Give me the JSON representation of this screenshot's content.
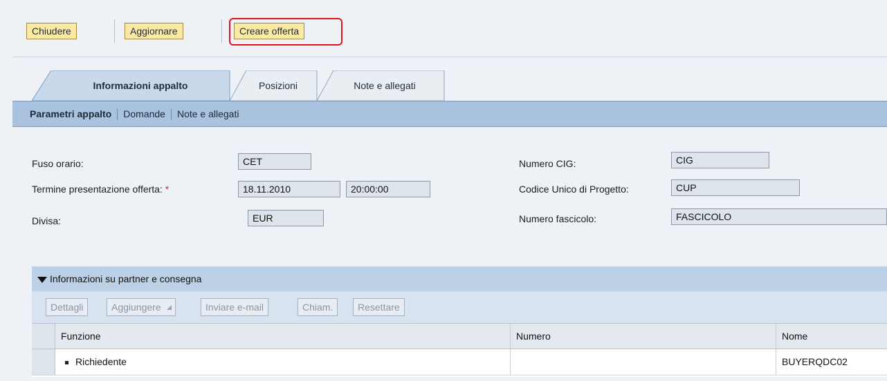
{
  "toolbar": {
    "close_label": "Chiudere",
    "update_label": "Aggiornare",
    "create_offer_label": "Creare offerta"
  },
  "tabs": [
    {
      "label": "Informazioni appalto",
      "active": true
    },
    {
      "label": "Posizioni",
      "active": false
    },
    {
      "label": "Note e allegati",
      "active": false
    }
  ],
  "subnav": {
    "items": [
      "Parametri appalto",
      "Domande",
      "Note e allegati"
    ]
  },
  "form": {
    "timezone_label": "Fuso orario:",
    "timezone_value": "CET",
    "deadline_label": "Termine presentazione offerta:",
    "required_marker": "*",
    "deadline_date": "18.11.2010",
    "deadline_time": "20:00:00",
    "currency_label": "Divisa:",
    "currency_value": "EUR",
    "cig_label": "Numero CIG:",
    "cig_value": "CIG",
    "cup_label": "Codice Unico di Progetto:",
    "cup_value": "CUP",
    "file_label": "Numero fascicolo:",
    "file_value": "FASCICOLO"
  },
  "partner_section": {
    "title": "Informazioni su partner e consegna",
    "buttons": {
      "details": "Dettagli",
      "add": "Aggiungere",
      "send_email": "Inviare e-mail",
      "call": "Chiam.",
      "reset": "Resettare"
    },
    "columns": [
      "Funzione",
      "Numero",
      "Nome"
    ],
    "rows": [
      {
        "function": "Richiedente",
        "number": "",
        "name": "BUYERQDC02"
      }
    ]
  },
  "colors": {
    "button_bg": "#fbe9a6",
    "highlight": "#e3131d",
    "subnav_bg": "#a9c2dd",
    "section_bg": "#bcd1e6"
  }
}
